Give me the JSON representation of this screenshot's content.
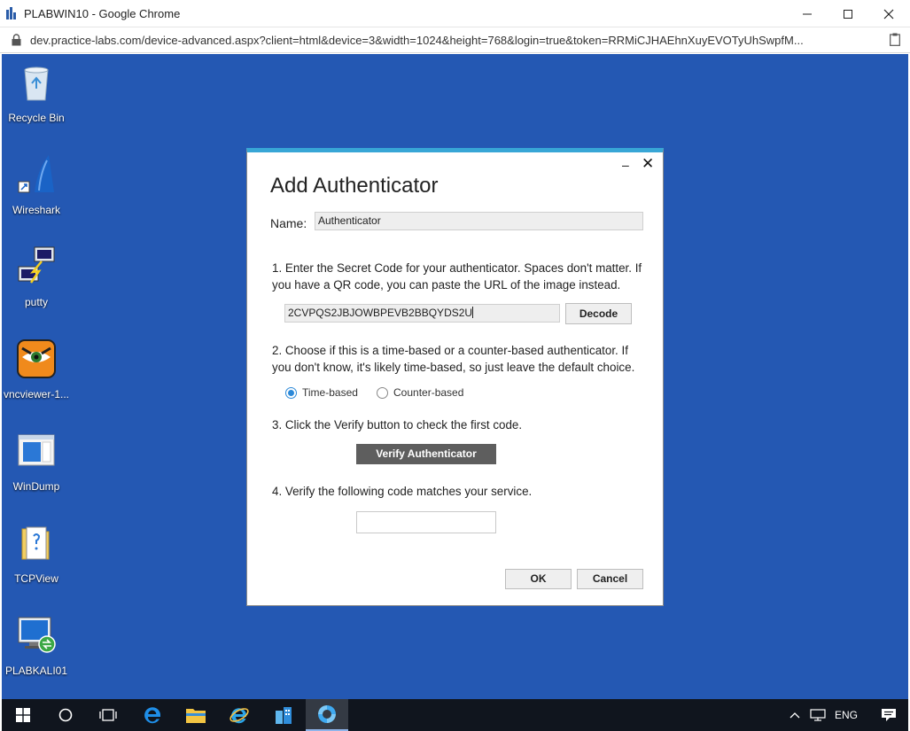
{
  "window": {
    "title": "PLABWIN10 - Google Chrome",
    "url": "dev.practice-labs.com/device-advanced.aspx?client=html&device=3&width=1024&height=768&login=true&token=RRMiCJHAEhnXuyEVOTyUhSwpfM..."
  },
  "desktop": {
    "icons": [
      {
        "label": "Recycle Bin"
      },
      {
        "label": "Wireshark"
      },
      {
        "label": "putty"
      },
      {
        "label": "vncviewer-1..."
      },
      {
        "label": "WinDump"
      },
      {
        "label": "TCPView"
      },
      {
        "label": "PLABKALI01"
      }
    ],
    "background_color": "#2458b3"
  },
  "dialog": {
    "title": "Add Authenticator",
    "minimize_glyph": "–",
    "close_glyph": "✕",
    "name_label": "Name:",
    "name_value": "Authenticator",
    "step1": "1. Enter the Secret Code for your authenticator. Spaces don't matter. If you have a QR code, you can paste the URL of the image instead.",
    "secret_value": "2CVPQS2JBJOWBPEVB2BBQYDS2U",
    "decode_label": "Decode",
    "step2": "2. Choose if this is a time-based or a counter-based authenticator. If you don't know, it's likely time-based, so just leave the default choice.",
    "radio_time": "Time-based",
    "radio_counter": "Counter-based",
    "selected_mode": "Time-based",
    "step3": "3. Click the Verify button to check the first code.",
    "verify_label": "Verify Authenticator",
    "step4": "4. Verify the following code matches your service.",
    "code_value": "",
    "ok_label": "OK",
    "cancel_label": "Cancel",
    "accent_color": "#38a6d6"
  },
  "taskbar": {
    "language": "ENG",
    "apps": [
      "start",
      "search",
      "task-view",
      "edge",
      "file-explorer",
      "internet-explorer",
      "buildings-app",
      "chrome-remote"
    ]
  }
}
